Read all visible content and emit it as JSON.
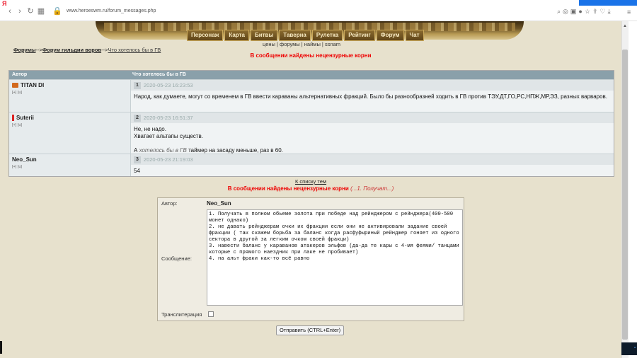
{
  "browser": {
    "brand": "Я",
    "url": "www.heroeswm.ru/forum_messages.php"
  },
  "menu": [
    "Персонаж",
    "Карта",
    "Битвы",
    "Таверна",
    "Рулетка",
    "Рейтинг",
    "Форум",
    "Чат"
  ],
  "submenu": "цены | форумы | наймы | ssnam",
  "breadcrumb": {
    "forums": "Форумы",
    "sep1": "-->",
    "guild": "Форум гильдии воров",
    "sep2": "-->",
    "topic": "Что хотелось бы в ГВ"
  },
  "warning": "В сообщении найдены нецензурные корни",
  "table": {
    "col_author": "Автор",
    "col_topic": "Что хотелось бы в ГВ",
    "author_links": "[+] [u]"
  },
  "posts": [
    {
      "author": "TITAN DI",
      "num": "1",
      "date": "2020-05-23 16:23:53",
      "text": "Народ, как думаете, могут со временем в ГВ ввести караваны альтернативных фракций. Было бы разнообразней ходить в ГВ против ТЭУ,ДТ,ГО,РС,НПЖ,МР,ЭЗ, разных варваров."
    },
    {
      "author": "Suterii",
      "num": "2",
      "date": "2020-05-23 16:51:37",
      "line1": "Не, не надо.",
      "line2": "Хватает альтапы существ.",
      "line3_a": "А ",
      "line3_em": "хотелось бы в ГВ",
      "line3_b": " таймер на засаду меньше, раз в 60."
    },
    {
      "author": "Neo_Sun",
      "num": "3",
      "date": "2020-05-23 21:19:03",
      "text": "54"
    }
  ],
  "back_link": "К списку тем",
  "warning2": {
    "text": "В сообщении найдены нецензурные корни",
    "em": "(...1. Получат...)"
  },
  "form": {
    "author_label": "Автор:",
    "author_value": "Neo_Sun",
    "message_label": "Сообщение:",
    "message_value": "1. Получать в полном обьеме золота при победе над рейнджером с рейнджера(400-500 монет однако)\n2. не давать рейнджерам очки их фракции если они не активировали задание своей фракции ( так скажем борьба за баланс когда расфуфыриный рейнджер гоняет из одного сектора в другой за легким очком своей фракци)\n3. навести баланс у караванов атакеров эльфов (да-да те кары с 4-мя феями/ танцами которые с прямого наездник при лаке не пробивает)\n4. на альт фраки как-то всё равно",
    "translit_label": "Транслитерация",
    "submit_label": "Отправить (CTRL+Enter)"
  }
}
